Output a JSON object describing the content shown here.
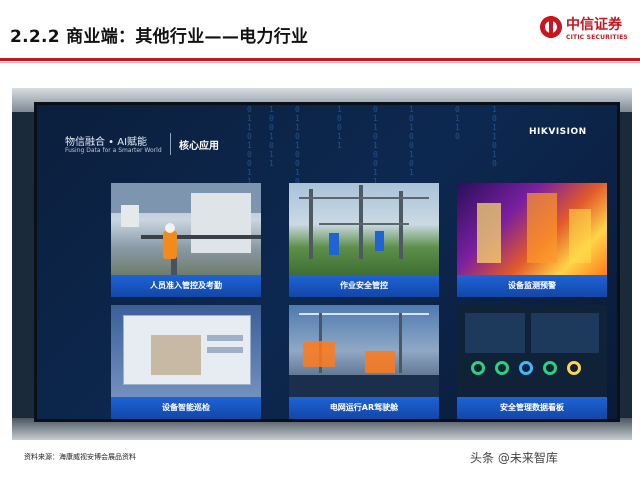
{
  "header": {
    "title": "2.2.2 商业端：其他行业——电力行业",
    "logo_cn": "中信证券",
    "logo_en": "CITIC SECURITIES"
  },
  "screen": {
    "brand_cn": "物信融合 • AI赋能",
    "brand_en": "Fusing Data for a Smarter World",
    "section": "核心应用",
    "vendor": "HIKVISION",
    "tiles": [
      {
        "label": "人员准入管控及考勤"
      },
      {
        "label": "作业安全管控"
      },
      {
        "label": "设备监测预警"
      },
      {
        "label": "设备智能巡检"
      },
      {
        "label": "电网运行AR驾驶舱"
      },
      {
        "label": "安全管理数据看板"
      }
    ]
  },
  "footer": {
    "source": "资料来源：海康威视安博会展品资料",
    "watermark": "头条 @未来智库"
  },
  "colors": {
    "accent": "#c9151e",
    "tile_label": "#1f63d6"
  }
}
